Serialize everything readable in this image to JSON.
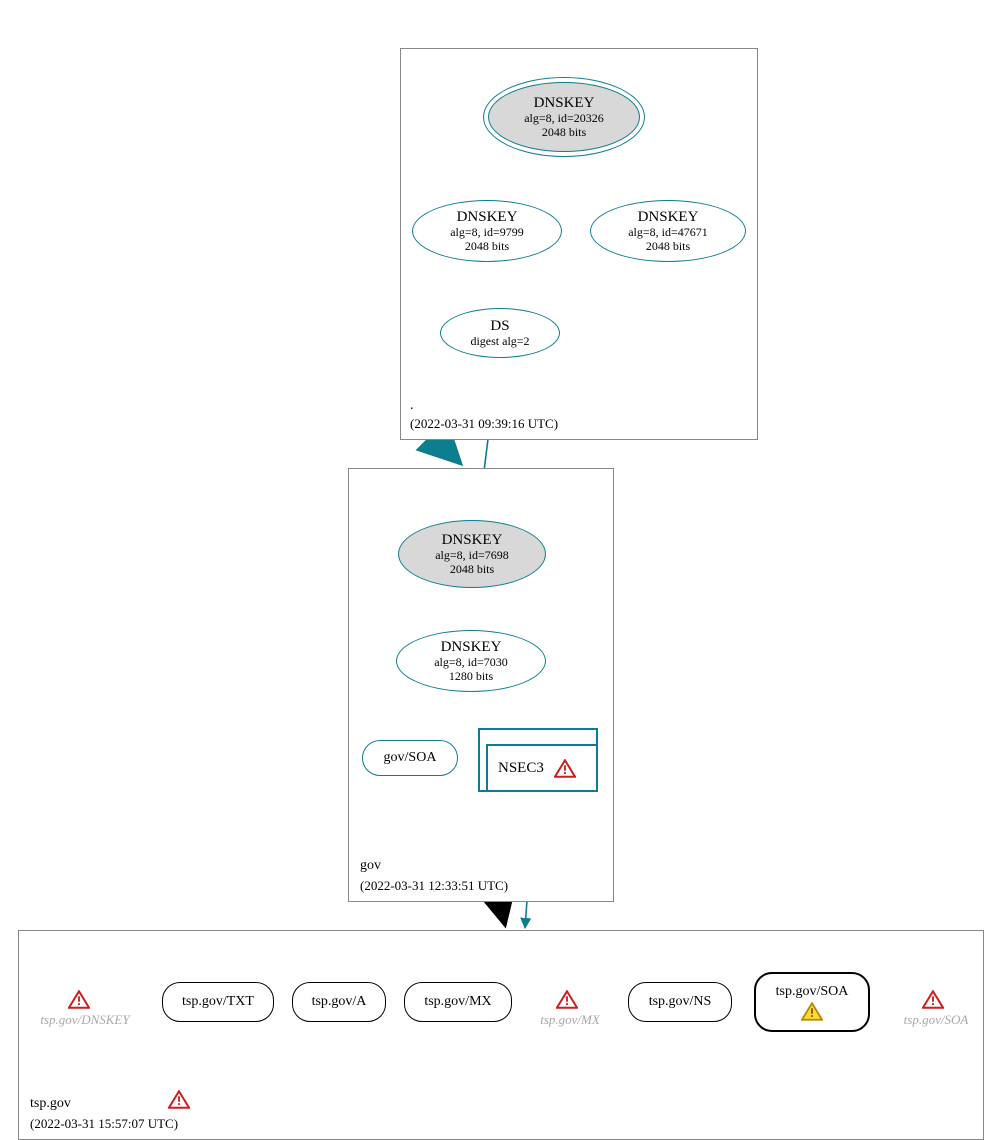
{
  "zones": {
    "root": {
      "name": ".",
      "timestamp": "(2022-03-31 09:39:16 UTC)",
      "nodes": {
        "ksk": {
          "title": "DNSKEY",
          "line2": "alg=8, id=20326",
          "line3": "2048 bits"
        },
        "zsk1": {
          "title": "DNSKEY",
          "line2": "alg=8, id=9799",
          "line3": "2048 bits"
        },
        "zsk2": {
          "title": "DNSKEY",
          "line2": "alg=8, id=47671",
          "line3": "2048 bits"
        },
        "ds": {
          "title": "DS",
          "line2": "digest alg=2"
        }
      }
    },
    "gov": {
      "name": "gov",
      "timestamp": "(2022-03-31 12:33:51 UTC)",
      "nodes": {
        "ksk": {
          "title": "DNSKEY",
          "line2": "alg=8, id=7698",
          "line3": "2048 bits"
        },
        "zsk": {
          "title": "DNSKEY",
          "line2": "alg=8, id=7030",
          "line3": "1280 bits"
        },
        "soa": {
          "label": "gov/SOA"
        },
        "nsec3": {
          "label": "NSEC3"
        }
      }
    },
    "tsp": {
      "name": "tsp.gov",
      "timestamp": "(2022-03-31 15:57:07 UTC)",
      "ghosts": {
        "dnskey": "tsp.gov/DNSKEY",
        "mx": "tsp.gov/MX",
        "soa": "tsp.gov/SOA"
      },
      "records": {
        "txt": "tsp.gov/TXT",
        "a": "tsp.gov/A",
        "mx": "tsp.gov/MX",
        "ns": "tsp.gov/NS",
        "soa": "tsp.gov/SOA"
      }
    }
  }
}
